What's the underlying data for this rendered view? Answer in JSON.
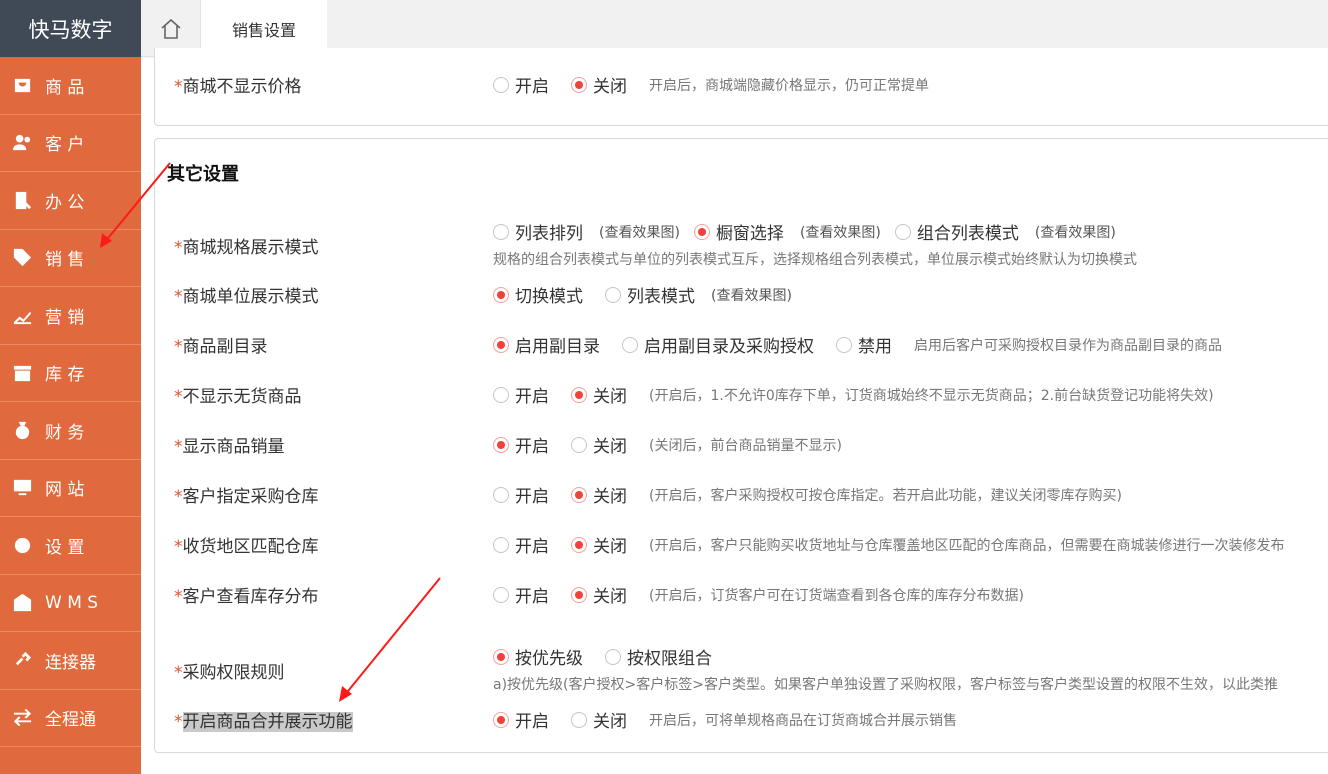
{
  "app": {
    "title": "快马数字"
  },
  "sidebar": {
    "items": [
      {
        "label": "商 品",
        "icon": "bag-icon"
      },
      {
        "label": "客 户",
        "icon": "users-icon"
      },
      {
        "label": "办 公",
        "icon": "office-icon"
      },
      {
        "label": "销 售",
        "icon": "tag-icon"
      },
      {
        "label": "营 销",
        "icon": "trend-icon"
      },
      {
        "label": "库 存",
        "icon": "storage-icon"
      },
      {
        "label": "财 务",
        "icon": "money-bag-icon"
      },
      {
        "label": "网 站",
        "icon": "monitor-icon"
      },
      {
        "label": "设 置",
        "icon": "gear-icon"
      },
      {
        "label": "W M S",
        "icon": "warehouse-icon"
      },
      {
        "label": "连接器",
        "icon": "link-icon"
      },
      {
        "label": "全程通",
        "icon": "exchange-icon"
      }
    ]
  },
  "tabs": {
    "active": "销售设置"
  },
  "top_setting": {
    "label": "商城不显示价格",
    "options": [
      "开启",
      "关闭"
    ],
    "selected": 1,
    "hint": "开启后，商城端隐藏价格显示，仍可正常提单"
  },
  "section": {
    "title": "其它设置",
    "rows": [
      {
        "label": "商城规格展示模式",
        "options": [
          "列表排列",
          "橱窗选择",
          "组合列表模式"
        ],
        "effects": [
          "(查看效果图)",
          "(查看效果图)",
          "(查看效果图)"
        ],
        "selected": 1,
        "sub": "规格的组合列表模式与单位的列表模式互斥，选择规格组合列表模式，单位展示模式始终默认为切换模式"
      },
      {
        "label": "商城单位展示模式",
        "options": [
          "切换模式",
          "列表模式"
        ],
        "effects": [
          "",
          "(查看效果图)"
        ],
        "selected": 0
      },
      {
        "label": "商品副目录",
        "options": [
          "启用副目录",
          "启用副目录及采购授权",
          "禁用"
        ],
        "selected": 0,
        "hint": "启用后客户可采购授权目录作为商品副目录的商品"
      },
      {
        "label": "不显示无货商品",
        "options": [
          "开启",
          "关闭"
        ],
        "selected": 1,
        "hint": "(开启后，1.不允许0库存下单，订货商城始终不显示无货商品；2.前台缺货登记功能将失效)"
      },
      {
        "label": "显示商品销量",
        "options": [
          "开启",
          "关闭"
        ],
        "selected": 0,
        "hint": "(关闭后，前台商品销量不显示)"
      },
      {
        "label": "客户指定采购仓库",
        "options": [
          "开启",
          "关闭"
        ],
        "selected": 1,
        "hint": "(开启后，客户采购授权可按仓库指定。若开启此功能，建议关闭零库存购买)"
      },
      {
        "label": "收货地区匹配仓库",
        "options": [
          "开启",
          "关闭"
        ],
        "selected": 1,
        "hint": "(开启后，客户只能购买收货地址与仓库覆盖地区匹配的仓库商品，但需要在商城装修进行一次装修发布"
      },
      {
        "label": "客户查看库存分布",
        "options": [
          "开启",
          "关闭"
        ],
        "selected": 1,
        "hint": "(开启后，订货客户可在订货端查看到各仓库的库存分布数据)"
      },
      {
        "label": "采购权限规则",
        "options": [
          "按优先级",
          "按权限组合"
        ],
        "selected": 0,
        "sub": "a)按优先级(客户授权>客户标签>客户类型。如果客户单独设置了采购权限，客户标签与客户类型设置的权限不生效，以此类推"
      },
      {
        "label": "开启商品合并展示功能",
        "options": [
          "开启",
          "关闭"
        ],
        "selected": 0,
        "hint": "开启后，可将单规格商品在订货商城合并展示销售"
      }
    ]
  },
  "colors": {
    "sidebar": "#e06a3d",
    "logo_bg": "#3f4a56",
    "required": "#e0532e",
    "radio_on": "#f0413a",
    "arrow": "#ff1a1a"
  }
}
